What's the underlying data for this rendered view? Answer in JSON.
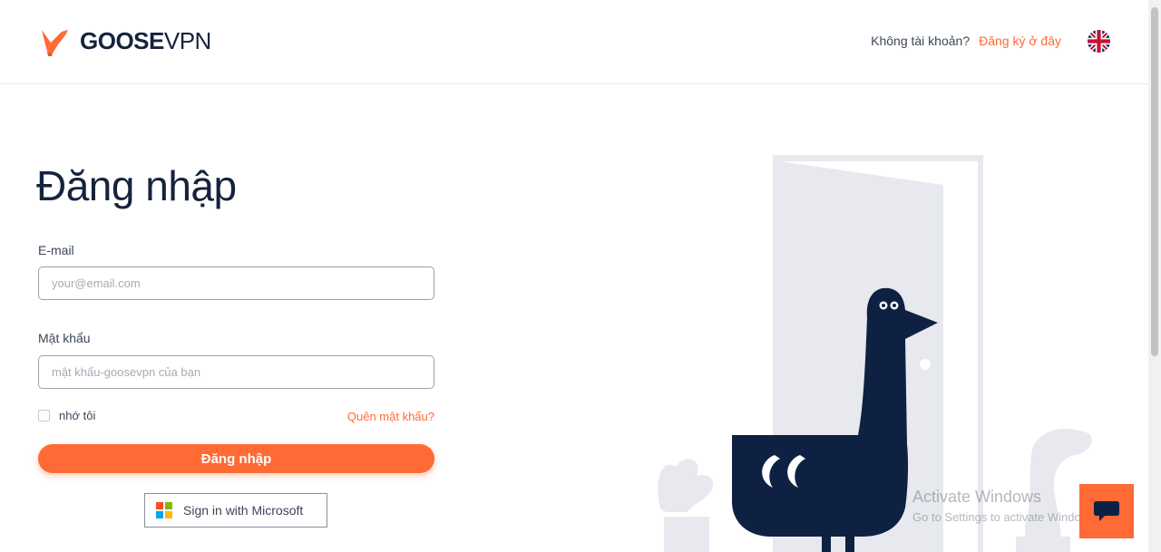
{
  "header": {
    "logo_bold": "GOOSE",
    "logo_light": "VPN",
    "no_account_text": "Không tài khoản?",
    "signup_link": "Đăng ký ở đây",
    "language_icon": "uk-flag-icon"
  },
  "form": {
    "title": "Đăng nhập",
    "email_label": "E-mail",
    "email_placeholder": "your@email.com",
    "email_value": "",
    "password_label": "Mật khẩu",
    "password_placeholder": "mật khẩu-goosevpn của bạn",
    "password_value": "",
    "remember_label": "nhớ tôi",
    "remember_checked": false,
    "forgot_link": "Quên mật khẩu?",
    "login_button": "Đăng nhập",
    "microsoft_button": "Sign in with Microsoft"
  },
  "watermark": {
    "title": "Activate Windows",
    "subtitle": "Go to Settings to activate Windows."
  },
  "colors": {
    "accent": "#ff6a35",
    "navy": "#15233d",
    "door": "#e7e9ee"
  },
  "chat": {
    "icon": "chat-bubble-icon"
  }
}
